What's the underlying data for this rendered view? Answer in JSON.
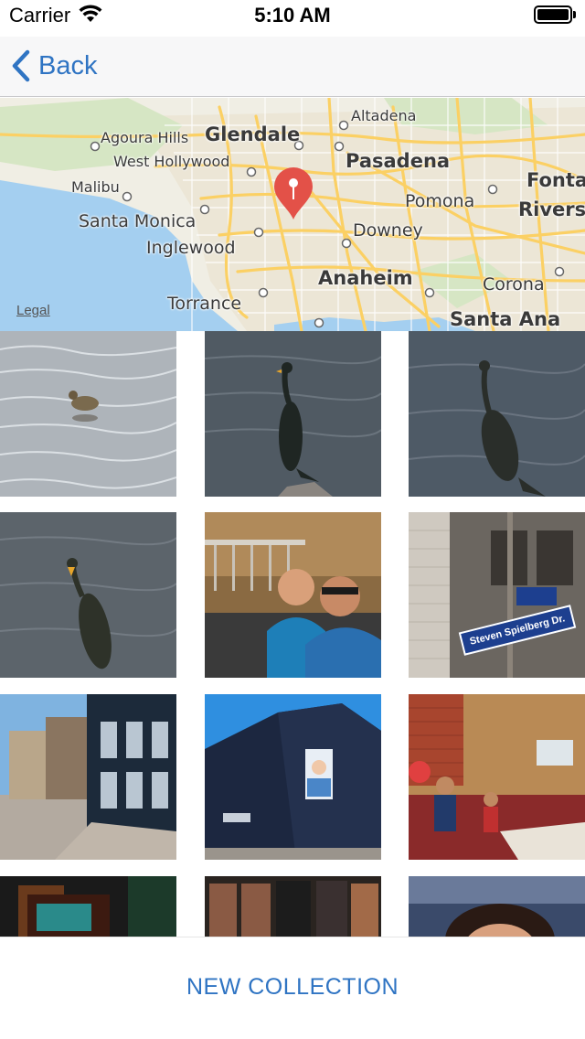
{
  "status_bar": {
    "carrier": "Carrier",
    "time": "5:10 AM"
  },
  "nav": {
    "back_label": "Back"
  },
  "map": {
    "legal": "Legal",
    "labels": {
      "altadena": "Altadena",
      "agoura_hills": "Agoura Hills",
      "glendale": "Glendale",
      "west_hollywood": "West Hollywood",
      "pasadena": "Pasadena",
      "fontana": "Fonta",
      "malibu": "Malibu",
      "pomona": "Pomona",
      "riverside": "Rivers",
      "santa_monica": "Santa Monica",
      "downey": "Downey",
      "inglewood": "Inglewood",
      "anaheim": "Anaheim",
      "corona": "Corona",
      "torrance": "Torrance",
      "santa_ana": "Santa Ana"
    }
  },
  "photos": {
    "street_sign": "Steven Spielberg Dr."
  },
  "footer": {
    "new_collection_label": "NEW COLLECTION"
  },
  "colors": {
    "accent": "#2f74c3",
    "pin": "#e35148",
    "water": "#a4cff0",
    "road": "#fbd064"
  }
}
